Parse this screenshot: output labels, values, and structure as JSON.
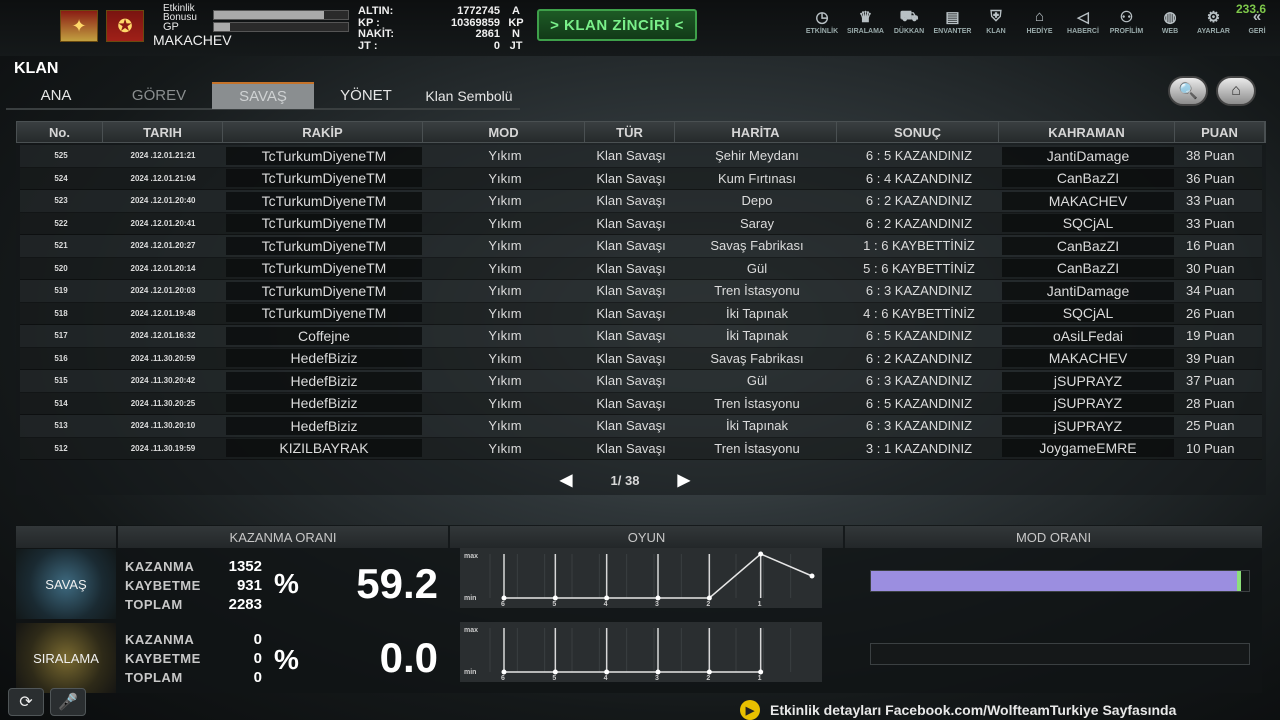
{
  "player": {
    "name": "MAKACHEV",
    "event_bonus_label": "Etkinlik Bonusu",
    "gp_label": "GP",
    "event_bonus_fill": 0.82,
    "gp_fill": 0.12
  },
  "currency": {
    "gold_label": "ALTIN:",
    "gold_value": "1772745",
    "gold_unit": "A",
    "kp_label": "KP :",
    "kp_value": "10369859",
    "kp_unit": "KP",
    "cash_label": "NAKİT:",
    "cash_value": "2861",
    "cash_unit": "N",
    "jt_label": "JT :",
    "jt_value": "0",
    "jt_unit": "JT"
  },
  "chain_button": "> KLAN ZİNCİRİ <",
  "fps": "233.6",
  "nav": [
    {
      "label": "ETKİNLİK",
      "icon": "clock-icon"
    },
    {
      "label": "SIRALAMA",
      "icon": "ranking-icon"
    },
    {
      "label": "DÜKKAN",
      "icon": "cart-icon"
    },
    {
      "label": "ENVANTER",
      "icon": "inventory-icon"
    },
    {
      "label": "KLAN",
      "icon": "shield-icon"
    },
    {
      "label": "HEDİYE",
      "icon": "gift-icon"
    },
    {
      "label": "HABERCİ",
      "icon": "megaphone-icon"
    },
    {
      "label": "PROFİLİM",
      "icon": "profile-icon"
    },
    {
      "label": "WEB",
      "icon": "globe-icon"
    },
    {
      "label": "AYARLAR",
      "icon": "gear-icon"
    },
    {
      "label": "GERİ",
      "icon": "back-icon"
    }
  ],
  "klan": {
    "title": "KLAN",
    "tabs": [
      "ANA",
      "GÖREV",
      "SAVAŞ",
      "YÖNET",
      "Klan Sembolü"
    ],
    "active_tab": "SAVAŞ"
  },
  "table": {
    "headers": [
      "No.",
      "TARIH",
      "RAKİP",
      "MOD",
      "TÜR",
      "HARİTA",
      "SONUÇ",
      "KAHRAMAN",
      "PUAN"
    ],
    "rows": [
      [
        "525",
        "2024 .12.01.21:21",
        "TcTurkumDiyeneTM",
        "Yıkım",
        "Klan Savaşı",
        "Şehir Meydanı",
        "6 : 5 KAZANDINIZ",
        "JantiDamage",
        "38 Puan"
      ],
      [
        "524",
        "2024 .12.01.21:04",
        "TcTurkumDiyeneTM",
        "Yıkım",
        "Klan Savaşı",
        "Kum Fırtınası",
        "6 : 4 KAZANDINIZ",
        "CanBazZI",
        "36 Puan"
      ],
      [
        "523",
        "2024 .12.01.20:40",
        "TcTurkumDiyeneTM",
        "Yıkım",
        "Klan Savaşı",
        "Depo",
        "6 : 2 KAZANDINIZ",
        "MAKACHEV",
        "33 Puan"
      ],
      [
        "522",
        "2024 .12.01.20:41",
        "TcTurkumDiyeneTM",
        "Yıkım",
        "Klan Savaşı",
        "Saray",
        "6 : 2 KAZANDINIZ",
        "SQCjAL",
        "33 Puan"
      ],
      [
        "521",
        "2024 .12.01.20:27",
        "TcTurkumDiyeneTM",
        "Yıkım",
        "Klan Savaşı",
        "Savaş Fabrikası",
        "1 : 6 KAYBETTİNİZ",
        "CanBazZI",
        "16 Puan"
      ],
      [
        "520",
        "2024 .12.01.20:14",
        "TcTurkumDiyeneTM",
        "Yıkım",
        "Klan Savaşı",
        "Gül",
        "5 : 6 KAYBETTİNİZ",
        "CanBazZI",
        "30 Puan"
      ],
      [
        "519",
        "2024 .12.01.20:03",
        "TcTurkumDiyeneTM",
        "Yıkım",
        "Klan Savaşı",
        "Tren İstasyonu",
        "6 : 3 KAZANDINIZ",
        "JantiDamage",
        "34 Puan"
      ],
      [
        "518",
        "2024 .12.01.19:48",
        "TcTurkumDiyeneTM",
        "Yıkım",
        "Klan Savaşı",
        "İki Tapınak",
        "4 : 6 KAYBETTİNİZ",
        "SQCjAL",
        "26 Puan"
      ],
      [
        "517",
        "2024 .12.01.16:32",
        "Coffejne",
        "Yıkım",
        "Klan Savaşı",
        "İki Tapınak",
        "6 : 5 KAZANDINIZ",
        "oAsiLFedai",
        "19 Puan"
      ],
      [
        "516",
        "2024 .11.30.20:59",
        "HedefBiziz",
        "Yıkım",
        "Klan Savaşı",
        "Savaş Fabrikası",
        "6 : 2 KAZANDINIZ",
        "MAKACHEV",
        "39 Puan"
      ],
      [
        "515",
        "2024 .11.30.20:42",
        "HedefBiziz",
        "Yıkım",
        "Klan Savaşı",
        "Gül",
        "6 : 3 KAZANDINIZ",
        "jSUPRAYZ",
        "37 Puan"
      ],
      [
        "514",
        "2024 .11.30.20:25",
        "HedefBiziz",
        "Yıkım",
        "Klan Savaşı",
        "Tren İstasyonu",
        "6 : 5 KAZANDINIZ",
        "jSUPRAYZ",
        "28 Puan"
      ],
      [
        "513",
        "2024 .11.30.20:10",
        "HedefBiziz",
        "Yıkım",
        "Klan Savaşı",
        "İki Tapınak",
        "6 : 3 KAZANDINIZ",
        "jSUPRAYZ",
        "25 Puan"
      ],
      [
        "512",
        "2024 .11.30.19:59",
        "KIZILBAYRAK",
        "Yıkım",
        "Klan Savaşı",
        "Tren İstasyonu",
        "3 : 1 KAZANDINIZ",
        "JoygameEMRE",
        "10 Puan"
      ]
    ]
  },
  "pager": {
    "text": "1/ 38"
  },
  "stats": {
    "headers": [
      "KAZANMA ORANI",
      "OYUN",
      "MOD ORANI"
    ],
    "labels": {
      "win": "KAZANMA",
      "loss": "KAYBETME",
      "total": "TOPLAM",
      "percent": "%",
      "max": "max",
      "min": "min"
    },
    "savas": {
      "mode": "SAVAŞ",
      "win": "1352",
      "loss": "931",
      "total": "2283",
      "rate": "59.2",
      "mode_ratio": 0.98
    },
    "siralama": {
      "mode": "SIRALAMA",
      "win": "0",
      "loss": "0",
      "total": "0",
      "rate": "0.0",
      "mode_ratio": 0
    }
  },
  "chart_data": [
    {
      "type": "line",
      "x": [
        "6",
        "5",
        "4",
        "3",
        "2",
        "1"
      ],
      "series": [
        {
          "values": [
            0,
            0,
            0,
            0,
            0,
            1
          ]
        }
      ],
      "extra_point_after_1": 0.5,
      "ylim": [
        "min",
        "max"
      ]
    },
    {
      "type": "line",
      "x": [
        "6",
        "5",
        "4",
        "3",
        "2",
        "1"
      ],
      "series": [
        {
          "values": [
            0,
            0,
            0,
            0,
            0,
            0
          ]
        }
      ],
      "ylim": [
        "min",
        "max"
      ]
    }
  ],
  "ticker": {
    "text": "Etkinlik detayları Facebook.com/WolfteamTurkiye Sayfasında"
  }
}
